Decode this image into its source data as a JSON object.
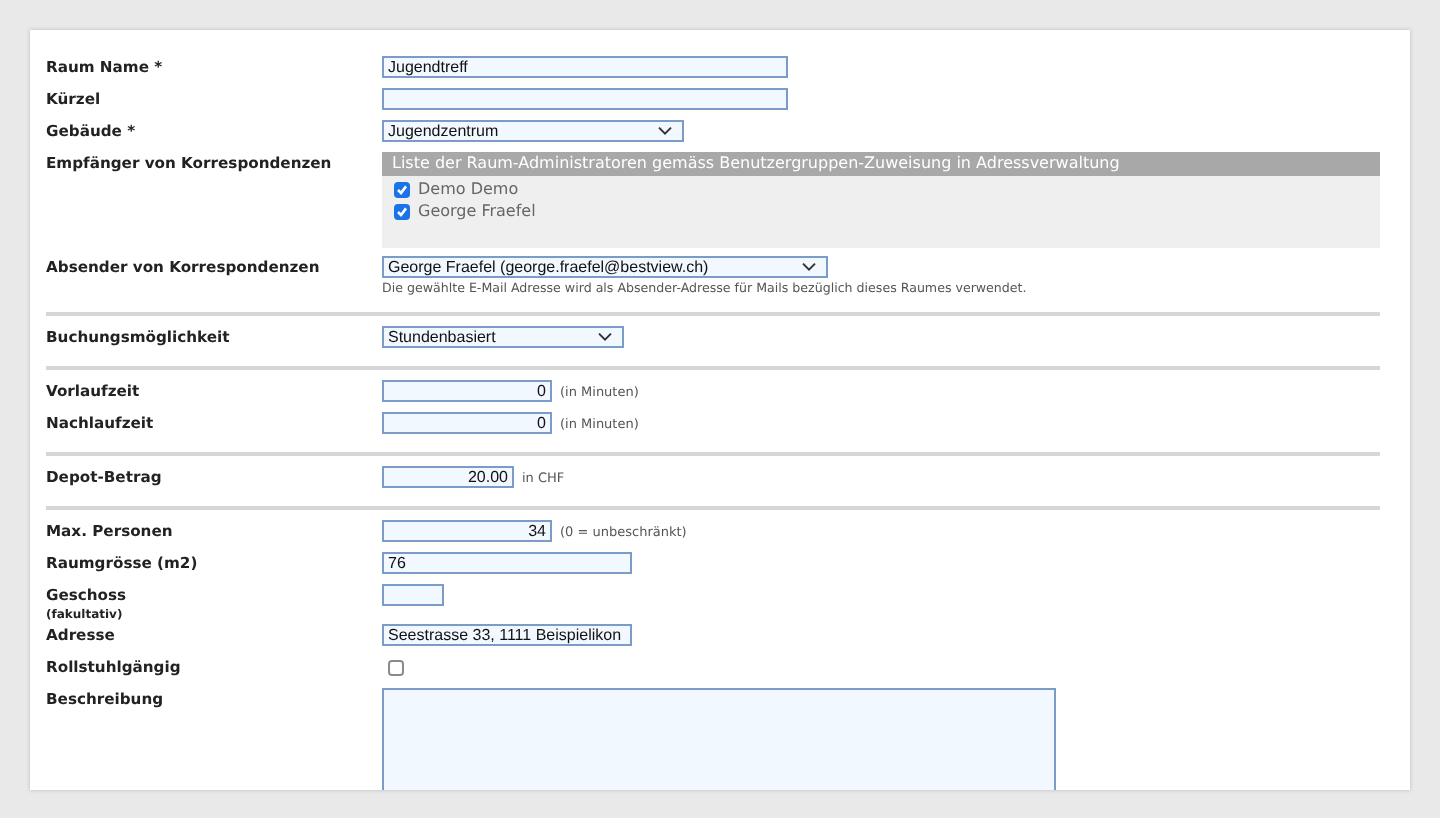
{
  "sections": [
    {
      "fields": [
        {
          "kind": "text",
          "label": "Raum Name *",
          "value": "Jugendtreff"
        },
        {
          "kind": "text",
          "label": "Kürzel"
        },
        {
          "kind": "select",
          "label": "Gebäude *",
          "value": "Jugendzentrum"
        },
        {
          "kind": "recipients",
          "label": "Empfänger von Korrespondenzen",
          "header": "Liste der Raum-Administratoren gemäss Benutzergruppen-Zuweisung in Adressverwaltung",
          "items": [
            {
              "label": "Demo Demo",
              "checked": true
            },
            {
              "label": "George Fraefel",
              "checked": true
            }
          ]
        },
        {
          "kind": "select",
          "label": "Absender von Korrespondenzen",
          "value": "George Fraefel (george.fraefel@bestview.ch)",
          "hint": "Die gewählte E-Mail Adresse wird als Absender-Adresse für Mails bezüglich dieses Raumes verwendet."
        }
      ]
    },
    {
      "fields": [
        {
          "kind": "select",
          "label": "Buchungsmöglichkeit",
          "value": "Stundenbasiert"
        }
      ]
    },
    {
      "fields": [
        {
          "kind": "number",
          "label": "Vorlaufzeit",
          "value": "0",
          "unit": "(in Minuten)"
        },
        {
          "kind": "number",
          "label": "Nachlaufzeit",
          "value": "0",
          "unit": "(in Minuten)"
        }
      ]
    },
    {
      "fields": [
        {
          "kind": "number",
          "label": "Depot-Betrag",
          "value": "20.00",
          "unit": "in CHF"
        }
      ]
    },
    {
      "fields": [
        {
          "kind": "number",
          "label": "Max. Personen",
          "value": "34",
          "unit": "(0 = unbeschränkt)"
        },
        {
          "kind": "text",
          "label": "Raumgrösse (m2)",
          "value": "76"
        },
        {
          "kind": "text",
          "label": "Geschoss",
          "sublabel": "(fakultativ)"
        },
        {
          "kind": "text",
          "label": "Adresse",
          "value": "Seestrasse 33, 1111 Beispielikon"
        },
        {
          "kind": "checkbox",
          "label": "Rollstuhlgängig",
          "checked": false
        },
        {
          "kind": "textarea",
          "label": "Beschreibung"
        }
      ]
    }
  ]
}
